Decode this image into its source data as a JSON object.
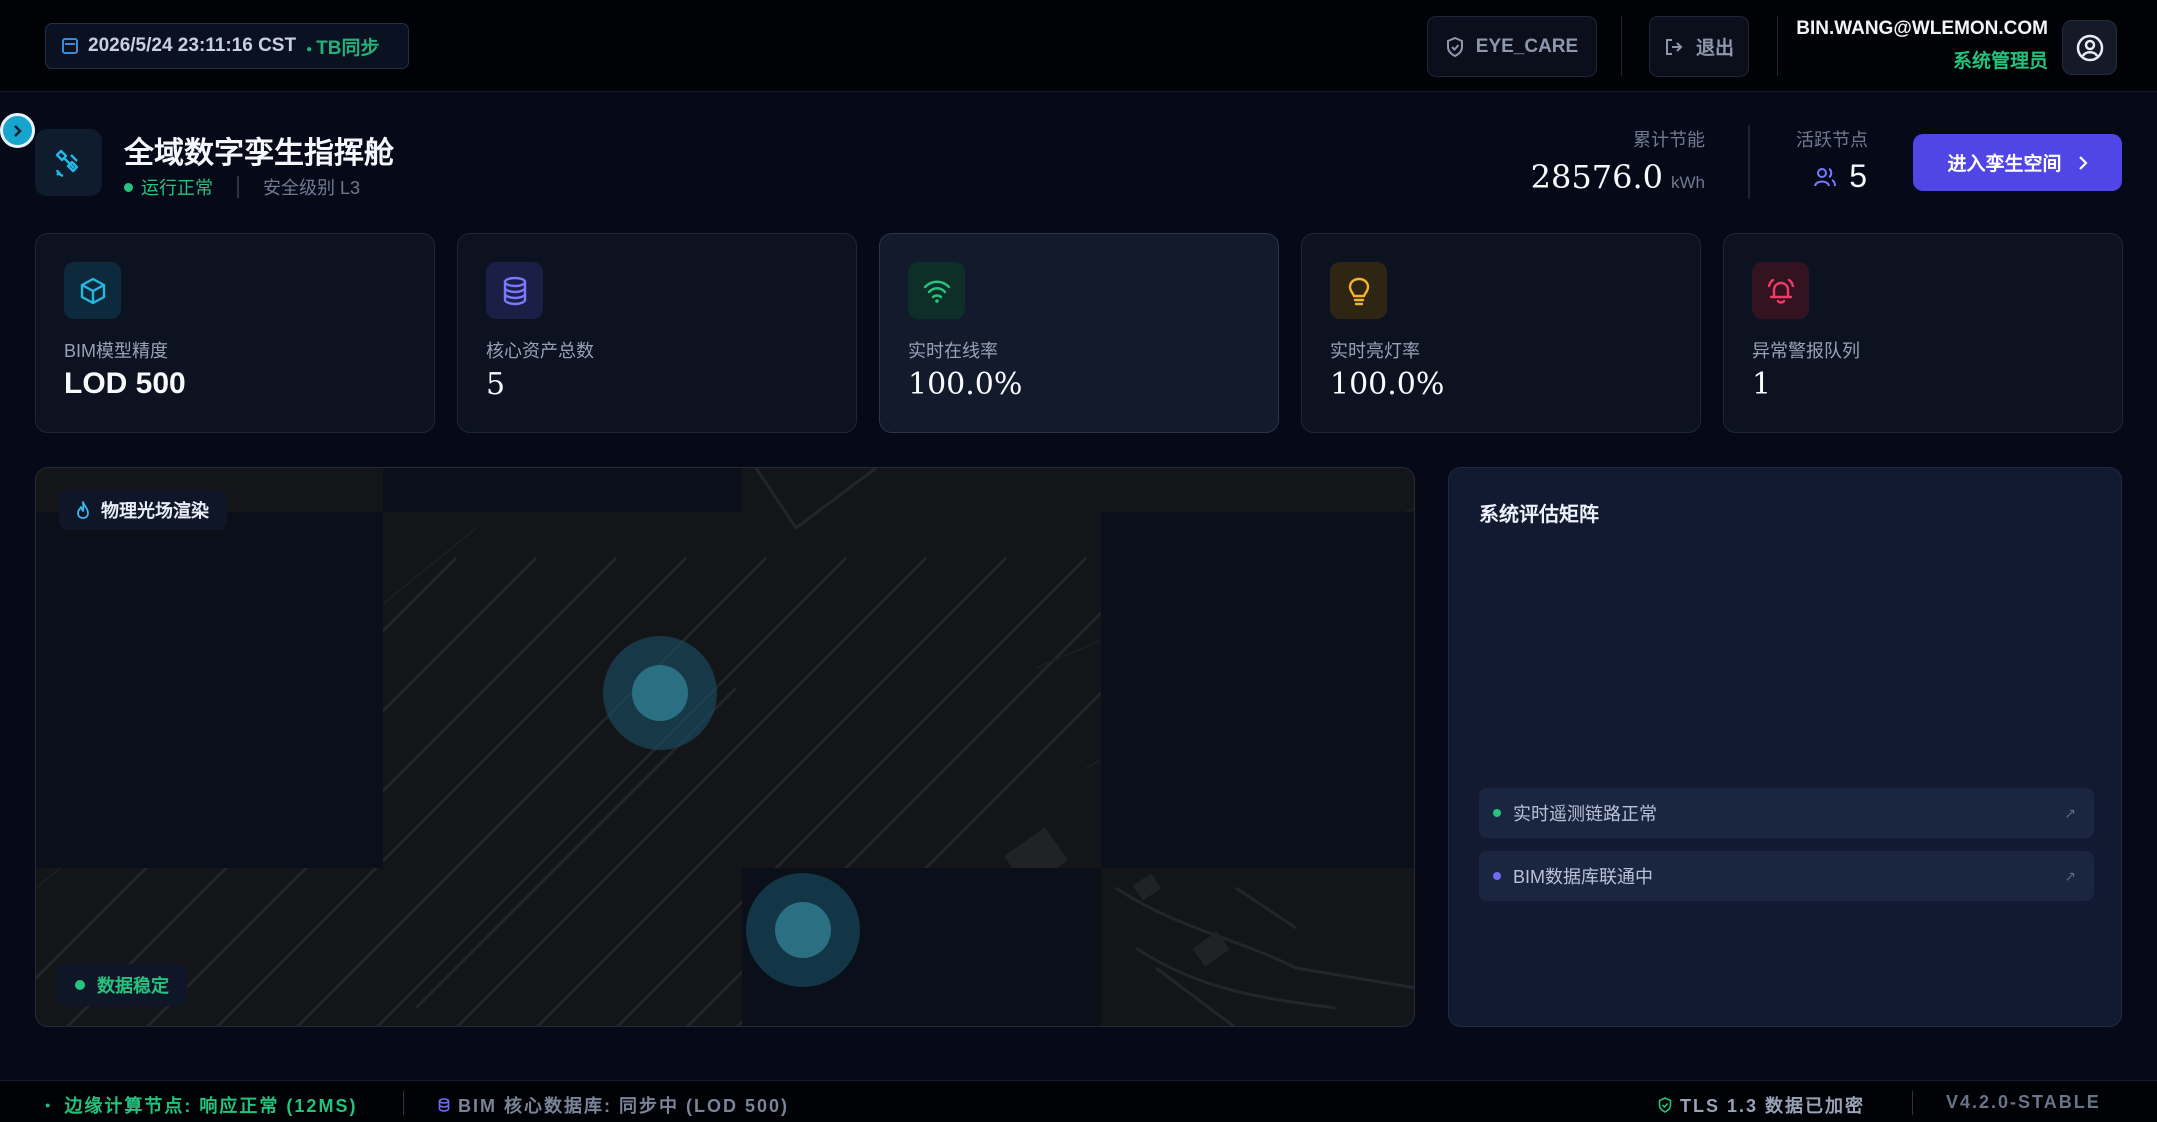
{
  "topbar": {
    "datetime": "2026/5/24 23:11:16 CST",
    "sync_status": "TB同步",
    "eye_care_label": "EYE_CARE",
    "exit_label": "退出",
    "user_email": "BIN.WANG@WLEMON.COM",
    "user_role": "系统管理员"
  },
  "header": {
    "title": "全域数字孪生指挥舱",
    "status": "运行正常",
    "security_level": "安全级别 L3",
    "energy_label": "累计节能",
    "energy_value": "28576.0",
    "energy_unit": "kWh",
    "nodes_label": "活跃节点",
    "nodes_value": "5",
    "enter_button": "进入孪生空间"
  },
  "cards": [
    {
      "label": "BIM模型精度",
      "value": "LOD 500",
      "icon": "cube-icon",
      "accent": "#27b6e0"
    },
    {
      "label": "核心资产总数",
      "value": "5",
      "icon": "database-icon",
      "accent": "#6f6cf0"
    },
    {
      "label": "实时在线率",
      "value": "100.0%",
      "icon": "wifi-icon",
      "accent": "#27c27e"
    },
    {
      "label": "实时亮灯率",
      "value": "100.0%",
      "icon": "bulb-icon",
      "accent": "#e3a92a"
    },
    {
      "label": "异常警报队列",
      "value": "1",
      "icon": "alarm-icon",
      "accent": "#e0365f"
    }
  ],
  "map": {
    "render_label": "物理光场渲染",
    "data_status": "数据稳定"
  },
  "assessment": {
    "title": "系统评估矩阵",
    "items": [
      {
        "label": "实时遥测链路正常",
        "dot_color": "#27c27e"
      },
      {
        "label": "BIM数据库联通中",
        "dot_color": "#6f6cf0"
      }
    ]
  },
  "footer": {
    "edge_node": "边缘计算节点: 响应正常 (12MS)",
    "bim_db": "BIM 核心数据库: 同步中 (LOD 500)",
    "tls": "TLS 1.3 数据已加密",
    "version": "V4.2.0-STABLE"
  }
}
